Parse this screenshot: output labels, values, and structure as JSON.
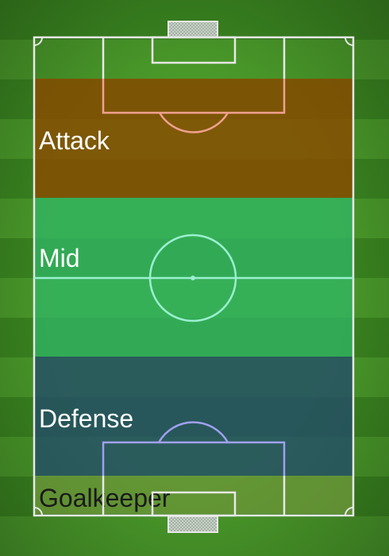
{
  "zones": {
    "attack": {
      "label": "Attack"
    },
    "mid": {
      "label": "Mid"
    },
    "defense": {
      "label": "Defense"
    },
    "goalkeeper": {
      "label": "Goalkeeper"
    }
  },
  "colors": {
    "grass_light": "#4a9a2a",
    "grass_dark": "#3a8520",
    "attack_zone": "#8a4a00",
    "mid_zone": "#2fb86a",
    "defense_zone": "#234a6a",
    "goalkeeper_zone": "#7aa040",
    "line_white": "#e8e8e8",
    "line_attack": "#f0a090",
    "line_mid": "#9af0d0",
    "line_defense": "#a0a0f0"
  }
}
